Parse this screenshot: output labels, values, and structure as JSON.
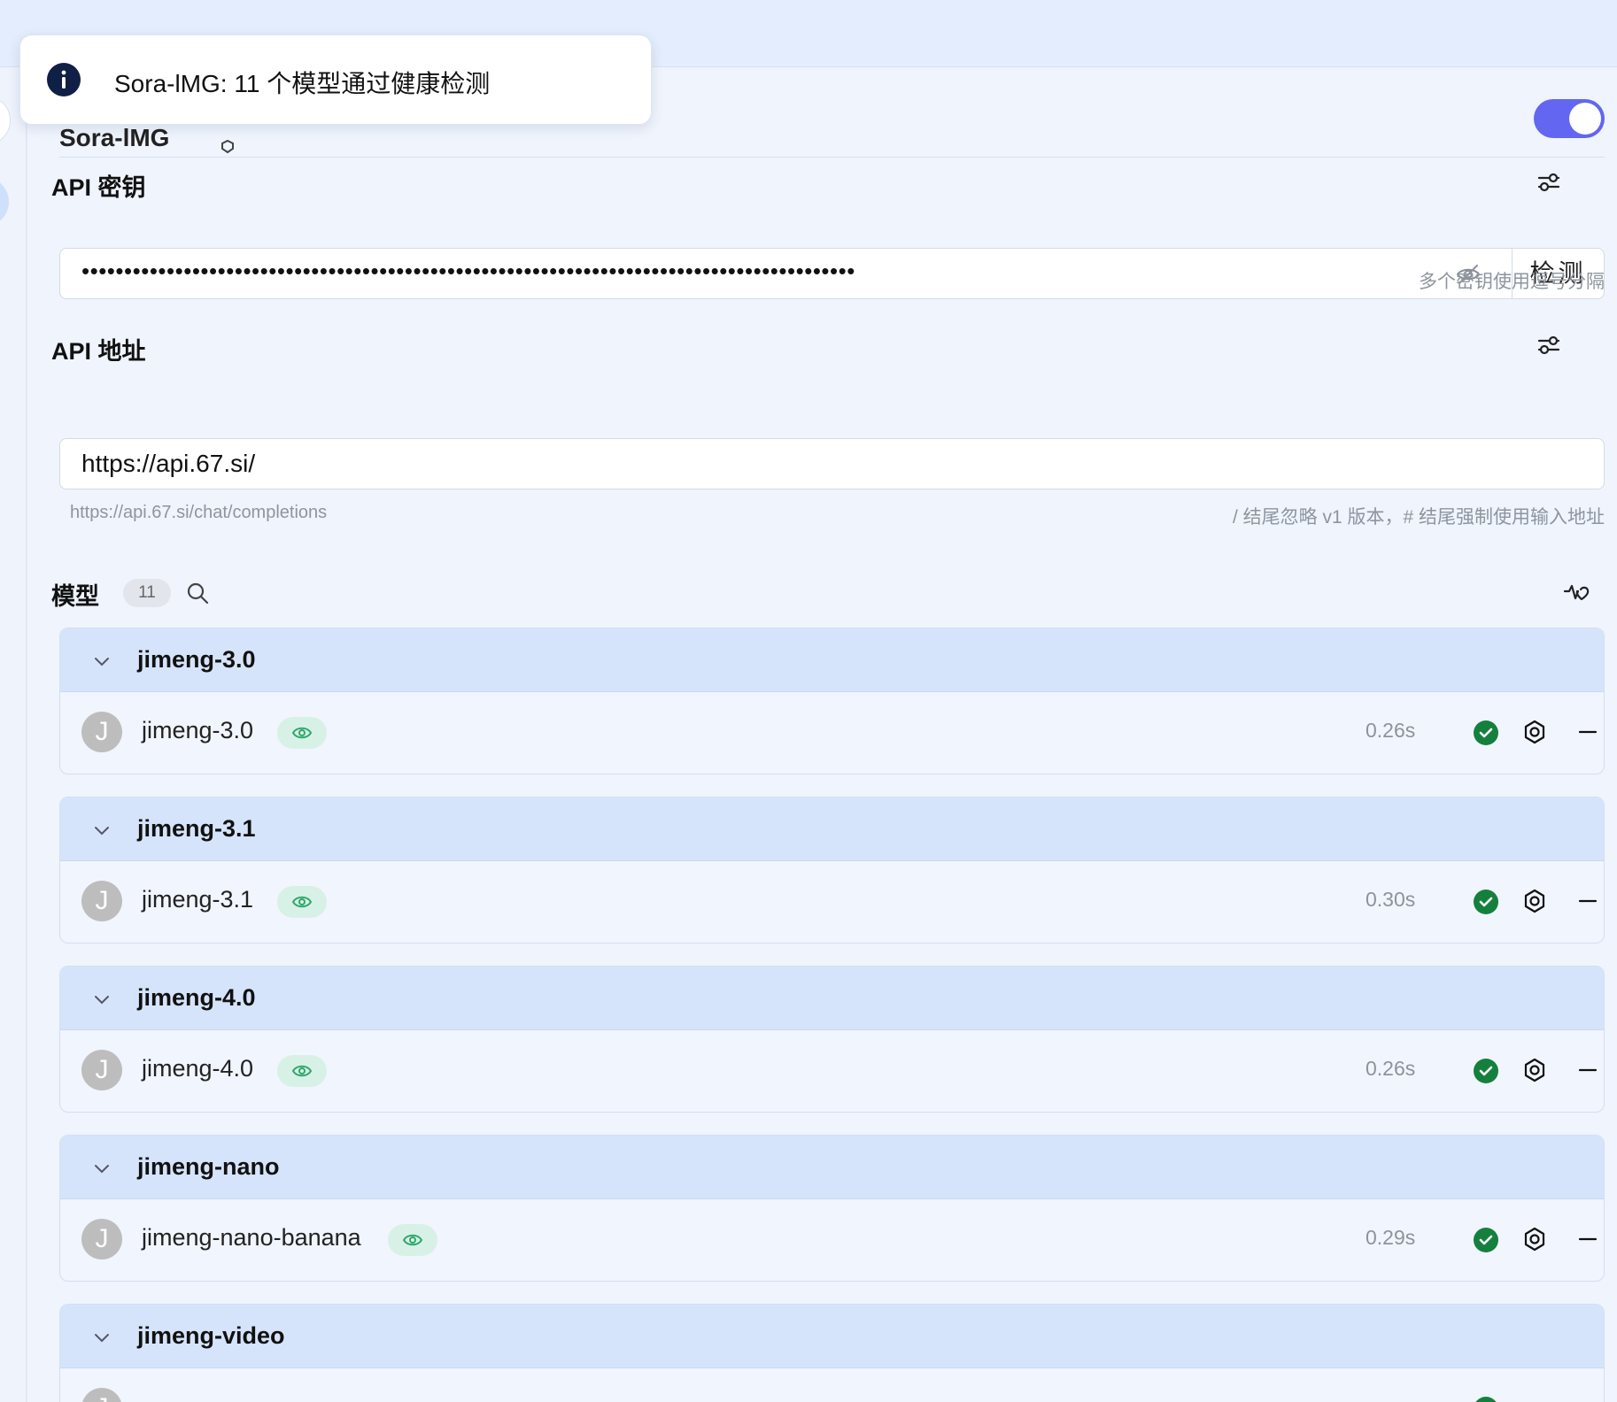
{
  "toast": {
    "message": "Sora-lMG: 11 个模型通过健康检测"
  },
  "provider": {
    "name": "Sora-lMG",
    "enabled": true,
    "accent_color": "#6366f1"
  },
  "api_key": {
    "label": "API 密钥",
    "value": "•••••••••••••••••••••••••••••••••••••••••••••••••••••••••••••••••••••••••••••••••••••••••••",
    "check_button": "检测",
    "hint": "多个密钥使用逗号分隔"
  },
  "api_host": {
    "label": "API 地址",
    "value": "https://api.67.si/",
    "preview": "https://api.67.si/chat/completions",
    "hint": "/ 结尾忽略 v1 版本，# 结尾强制使用输入地址"
  },
  "models": {
    "label": "模型",
    "count": "11",
    "groups": [
      {
        "title": "jimeng-3.0",
        "model": {
          "avatar": "J",
          "name": "jimeng-3.0",
          "latency": "0.26s",
          "status": "ok"
        }
      },
      {
        "title": "jimeng-3.1",
        "model": {
          "avatar": "J",
          "name": "jimeng-3.1",
          "latency": "0.30s",
          "status": "ok"
        }
      },
      {
        "title": "jimeng-4.0",
        "model": {
          "avatar": "J",
          "name": "jimeng-4.0",
          "latency": "0.26s",
          "status": "ok"
        }
      },
      {
        "title": "jimeng-nano",
        "model": {
          "avatar": "J",
          "name": "jimeng-nano-banana",
          "latency": "0.29s",
          "status": "ok"
        }
      },
      {
        "title": "jimeng-video",
        "model": {
          "avatar": "J",
          "name": "",
          "latency": "",
          "status": "ok"
        }
      }
    ]
  },
  "colors": {
    "ok_green": "#15803d",
    "vision_badge": "#d8f1e6",
    "group_header": "#d6e4fb"
  },
  "icons": [
    "info-icon",
    "eye-off-icon",
    "settings-sliders-icon",
    "search-icon",
    "health-check-icon",
    "chevron-down-icon",
    "eye-icon",
    "check-circle-icon",
    "gear-icon",
    "minus-icon"
  ]
}
